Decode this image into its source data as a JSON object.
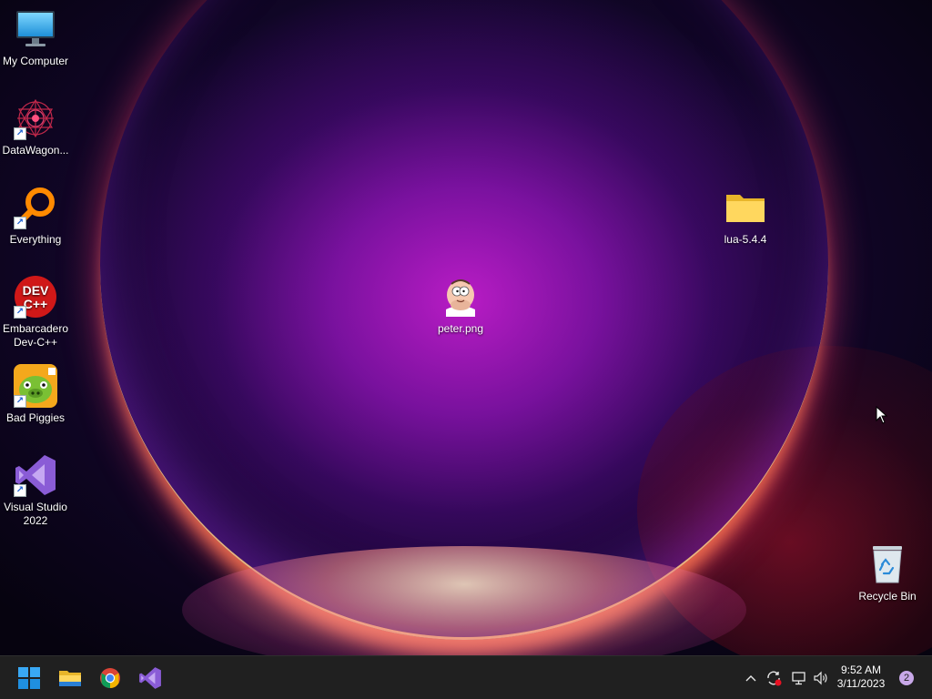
{
  "desktop": {
    "icons": [
      {
        "label": "My Computer",
        "icon": "monitor-icon"
      },
      {
        "label": "DataWagon...",
        "icon": "datawagon-icon"
      },
      {
        "label": "Everything",
        "icon": "everything-search-icon"
      },
      {
        "label": "Embarcadero Dev-C++",
        "icon": "dev-cpp-icon",
        "badge": "DEV C++"
      },
      {
        "label": "Bad Piggies",
        "icon": "bad-piggies-icon"
      },
      {
        "label": "Visual Studio 2022",
        "icon": "visual-studio-icon"
      },
      {
        "label": "lua-5.4.4",
        "icon": "folder-icon"
      },
      {
        "label": "peter.png",
        "icon": "image-file-icon"
      },
      {
        "label": "Recycle Bin",
        "icon": "recycle-bin-icon"
      }
    ]
  },
  "taskbar": {
    "pinned": [
      {
        "name": "Start",
        "icon": "windows-logo-icon"
      },
      {
        "name": "File Explorer",
        "icon": "folder-icon"
      },
      {
        "name": "Google Chrome",
        "icon": "chrome-icon"
      },
      {
        "name": "Visual Studio",
        "icon": "visual-studio-icon"
      }
    ],
    "tray": {
      "time": "9:52 AM",
      "date": "3/11/2023",
      "notification_count": "2"
    }
  },
  "colors": {
    "taskbar_bg": "#202020",
    "accent": "#0078d4",
    "wallpaper_core": "#b01cc8"
  }
}
